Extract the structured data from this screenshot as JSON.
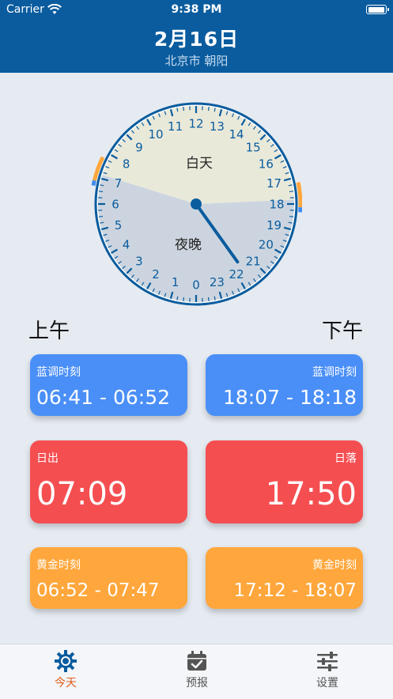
{
  "status_bar": {
    "carrier": "Carrier",
    "time": "9:38 PM",
    "battery_level": 1.0
  },
  "header": {
    "date": "2月16日",
    "location": "北京市 朝阳"
  },
  "clock": {
    "day_label": "白天",
    "night_label": "夜晚",
    "hour_numbers": [
      "0",
      "1",
      "2",
      "3",
      "4",
      "5",
      "6",
      "7",
      "8",
      "9",
      "10",
      "11",
      "12",
      "13",
      "14",
      "15",
      "16",
      "17",
      "18",
      "19",
      "20",
      "21",
      "22",
      "23"
    ],
    "sunrise_hour": 7.15,
    "sunset_hour": 17.83,
    "current_hour": 21.63,
    "day_color": "#e9e9da",
    "night_color": "#ccd5df",
    "rim_color": "#0a5c9e",
    "accent_blue": "#3f8cf5",
    "accent_orange": "#ffa73c"
  },
  "sections": {
    "am": "上午",
    "pm": "下午"
  },
  "cards": {
    "blue_am": {
      "label": "蓝调时刻",
      "value": "06:41 - 06:52"
    },
    "blue_pm": {
      "label": "蓝调时刻",
      "value": "18:07 - 18:18"
    },
    "sunrise": {
      "label": "日出",
      "value": "07:09"
    },
    "sunset": {
      "label": "日落",
      "value": "17:50"
    },
    "gold_am": {
      "label": "黄金时刻",
      "value": "06:52 - 07:47"
    },
    "gold_pm": {
      "label": "黄金时刻",
      "value": "17:12 - 18:07"
    }
  },
  "tabs": [
    {
      "label": "今天",
      "icon": "sun-icon",
      "active": true
    },
    {
      "label": "预报",
      "icon": "calendar-check-icon",
      "active": false
    },
    {
      "label": "设置",
      "icon": "sliders-icon",
      "active": false
    }
  ]
}
